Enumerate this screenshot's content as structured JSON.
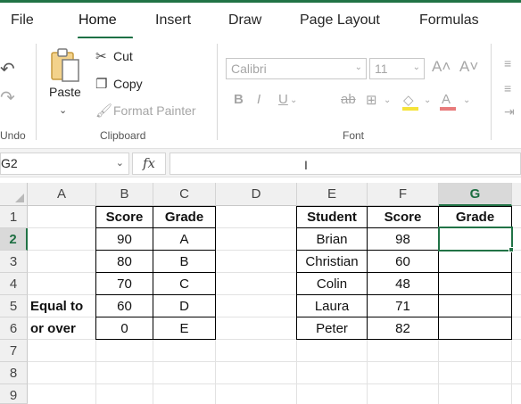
{
  "ribbon_tabs": [
    "File",
    "Home",
    "Insert",
    "Draw",
    "Page Layout",
    "Formulas"
  ],
  "ribbon": {
    "undo_group": "Undo",
    "clipboard": {
      "paste": "Paste",
      "cut": "Cut",
      "copy": "Copy",
      "format_painter": "Format Painter",
      "group_label": "Clipboard"
    },
    "font": {
      "font_name": "Calibri",
      "font_size": "11",
      "group_label": "Font"
    }
  },
  "formula_bar": {
    "name_box": "G2",
    "fx_label": "fx",
    "content": ""
  },
  "grid": {
    "columns": [
      "A",
      "B",
      "C",
      "D",
      "E",
      "F",
      "G"
    ],
    "rows": [
      "1",
      "2",
      "3",
      "4",
      "5",
      "6",
      "7",
      "8",
      "9"
    ],
    "selected_column": "G",
    "selected_row": "2",
    "label_a": [
      "Equal to",
      "or over"
    ],
    "lookup_table": {
      "headers": [
        "Score",
        "Grade"
      ],
      "rows": [
        [
          "90",
          "A"
        ],
        [
          "80",
          "B"
        ],
        [
          "70",
          "C"
        ],
        [
          "60",
          "D"
        ],
        [
          "0",
          "E"
        ]
      ]
    },
    "student_table": {
      "headers": [
        "Student",
        "Score",
        "Grade"
      ],
      "rows": [
        [
          "Brian",
          "98",
          ""
        ],
        [
          "Christian",
          "60",
          ""
        ],
        [
          "Colin",
          "48",
          ""
        ],
        [
          "Laura",
          "71",
          ""
        ],
        [
          "Peter",
          "82",
          ""
        ]
      ]
    }
  },
  "colors": {
    "accent": "#217346",
    "header_bg": "#f0f0f0"
  }
}
